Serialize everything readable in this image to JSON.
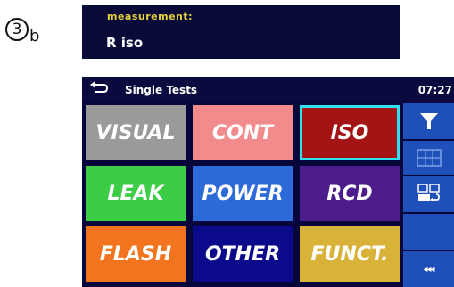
{
  "step": {
    "number": "3",
    "sub": "b"
  },
  "measurement": {
    "label": "measurement:",
    "value": "R iso"
  },
  "device": {
    "title": "Single Tests",
    "time": "07:27",
    "tiles": [
      {
        "label": "VISUAL",
        "color": "#9a9a9a"
      },
      {
        "label": "CONT",
        "color": "#f28b8b"
      },
      {
        "label": "ISO",
        "color": "#a51414",
        "selected": true
      },
      {
        "label": "LEAK",
        "color": "#3ccc46"
      },
      {
        "label": "POWER",
        "color": "#2d6ad9"
      },
      {
        "label": "RCD",
        "color": "#4b1c8a"
      },
      {
        "label": "FLASH",
        "color": "#f2741f"
      },
      {
        "label": "OTHER",
        "color": "#0a0a8a"
      },
      {
        "label": "FUNCT.",
        "color": "#d9b23a"
      }
    ],
    "side_buttons": [
      {
        "icon": "filter-icon"
      },
      {
        "icon": "grid-view-icon"
      },
      {
        "icon": "view-swap-icon"
      },
      {
        "icon": "blank"
      },
      {
        "icon": "more-icon",
        "label": "◂◂◂"
      }
    ],
    "colors": {
      "background": "#06063a",
      "side_panel": "#1f4fb8",
      "selection": "#2fe0f0",
      "label_yellow": "#e6d23a"
    }
  }
}
